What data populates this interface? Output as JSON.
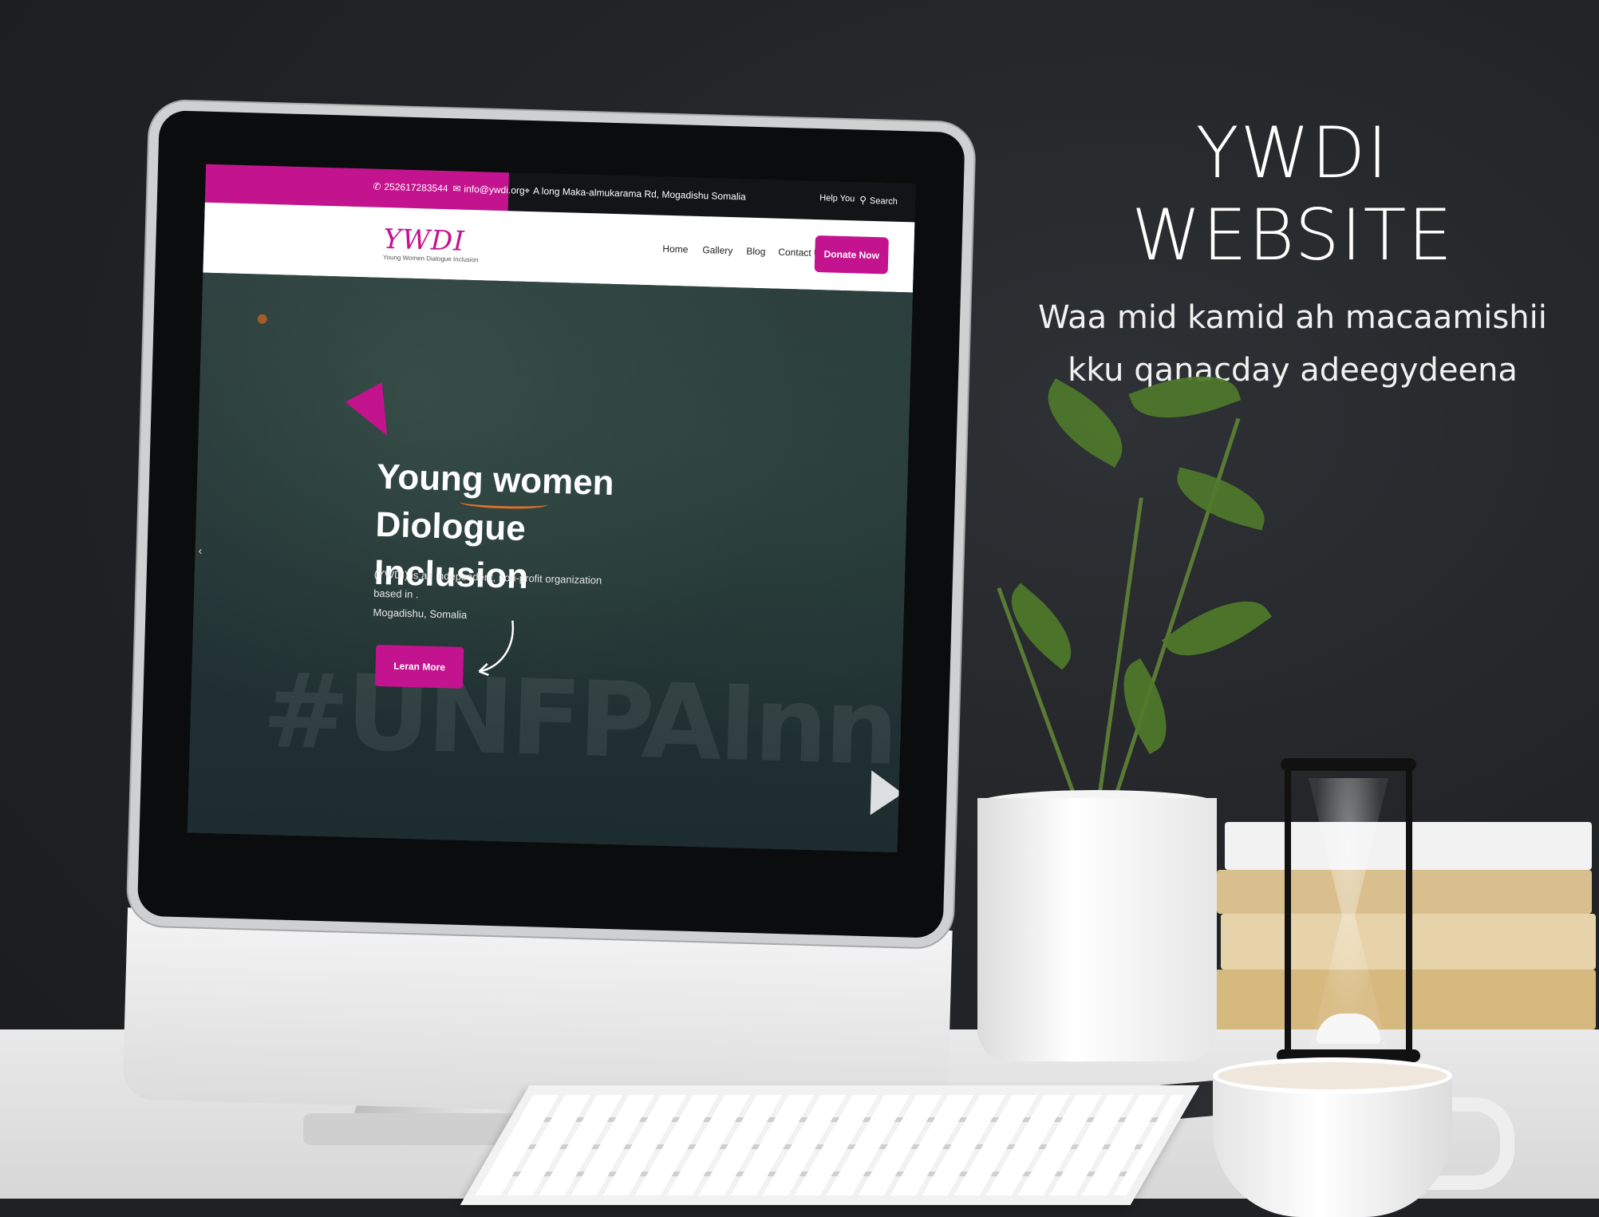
{
  "promo": {
    "headline": "YWDI WEBSITE",
    "subline_1": "Waa mid kamid ah macaamishii",
    "subline_2": "kku qanacday adeegydeena"
  },
  "website": {
    "topbar": {
      "phone": "252617283544",
      "email": "info@ywdi.org",
      "address": "A long Maka-almukarama Rd, Mogadishu Somalia",
      "help_label": "Help You",
      "search_label": "Search"
    },
    "logo": {
      "mark": "YWDI",
      "tagline": "Young Women Dialogue Inclusion"
    },
    "nav": {
      "home": "Home",
      "gallery": "Gallery",
      "blog": "Blog",
      "contact": "Contact Us",
      "donate": "Donate Now"
    },
    "hero": {
      "title_line_1": "Young women Diologue",
      "title_line_2": "Inclusion",
      "description_line_1": "(YWDI) is an independent, non-profit organization based in .",
      "description_line_2": "Mogadishu, Somalia",
      "cta": "Leran More",
      "watermark": "#UNFPAInnovatio"
    }
  },
  "colors": {
    "brand_magenta": "#c4138e",
    "topbar_dark": "#121417",
    "hero_teal": "#223335",
    "accent_orange": "#e0702a"
  },
  "icons": [
    "phone-icon",
    "mail-icon",
    "location-icon",
    "search-icon",
    "play-icon",
    "chevron-left-icon"
  ]
}
